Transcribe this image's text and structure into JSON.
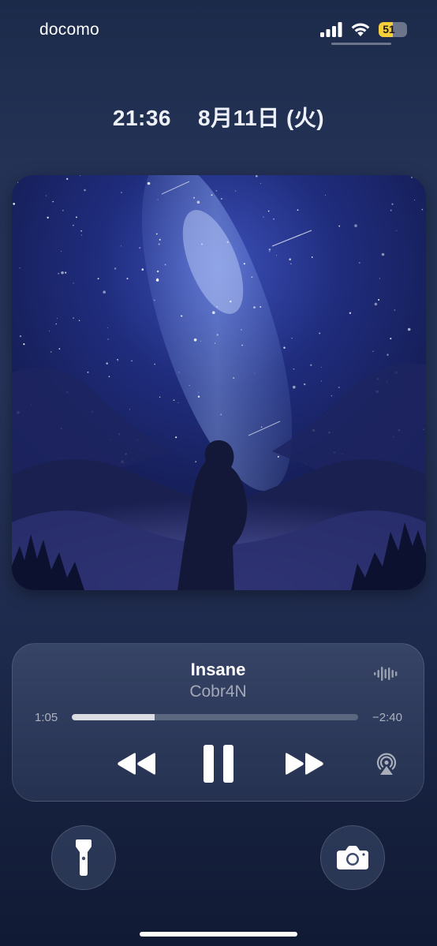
{
  "status_bar": {
    "carrier": "docomo",
    "battery_level": "51",
    "battery_fraction": 0.51,
    "signal_icon": "cellular-signal-icon",
    "wifi_icon": "wifi-icon"
  },
  "lock_screen": {
    "time": "21:36",
    "date": "8月11日 (火)"
  },
  "now_playing": {
    "artwork": "album-artwork",
    "title": "Insane",
    "artist": "Cobr4N",
    "elapsed": "1:05",
    "remaining": "−2:40",
    "progress_fraction": 0.29,
    "controls": {
      "rewind_icon": "rewind-icon",
      "pause_icon": "pause-icon",
      "forward_icon": "fast-forward-icon",
      "airplay_icon": "airplay-icon",
      "waveform_icon": "waveform-icon"
    }
  },
  "quick_actions": {
    "flashlight_icon": "flashlight-icon",
    "camera_icon": "camera-icon"
  },
  "colors": {
    "background_top": "#1c2a4a",
    "background_bottom": "#111a34",
    "battery_fill": "#f5cf3a",
    "player_panel": "#3e4c70"
  }
}
